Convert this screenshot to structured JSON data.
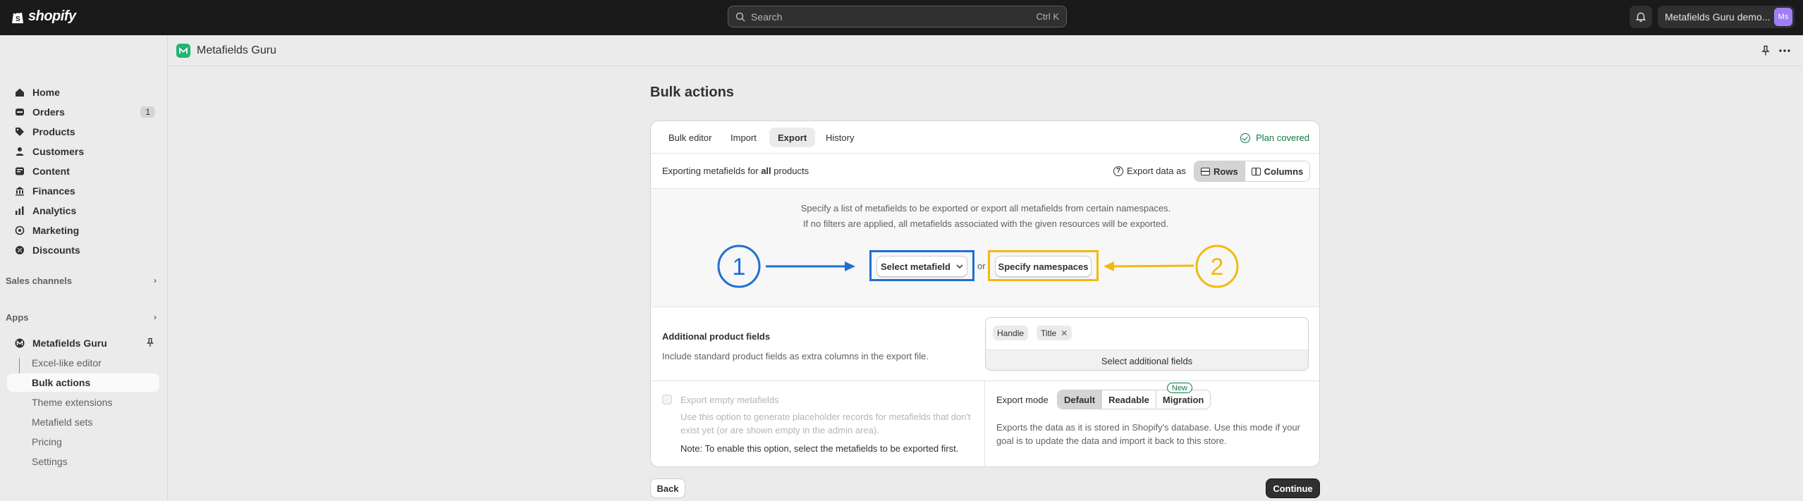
{
  "topbar": {
    "logo_text": "shopify",
    "search_placeholder": "Search",
    "search_shortcut": "Ctrl K",
    "store_name": "Metafields Guru demo...",
    "avatar_initials": "Ms"
  },
  "sidebar": {
    "items": [
      {
        "label": "Home",
        "icon": "home-icon"
      },
      {
        "label": "Orders",
        "icon": "orders-icon",
        "badge": "1"
      },
      {
        "label": "Products",
        "icon": "tag-icon"
      },
      {
        "label": "Customers",
        "icon": "person-icon"
      },
      {
        "label": "Content",
        "icon": "content-icon"
      },
      {
        "label": "Finances",
        "icon": "bank-icon"
      },
      {
        "label": "Analytics",
        "icon": "chart-icon"
      },
      {
        "label": "Marketing",
        "icon": "target-icon"
      },
      {
        "label": "Discounts",
        "icon": "discount-icon"
      }
    ],
    "sales_channels_label": "Sales channels",
    "apps_label": "Apps",
    "app_name": "Metafields Guru",
    "app_subitems": [
      "Excel-like editor",
      "Bulk actions",
      "Theme extensions",
      "Metafield sets",
      "Pricing",
      "Settings"
    ]
  },
  "app_header": {
    "title": "Metafields Guru"
  },
  "page": {
    "title": "Bulk actions",
    "tabs": [
      "Bulk editor",
      "Import",
      "Export",
      "History"
    ],
    "plan_status": "Plan covered",
    "exporting_prefix": "Exporting metafields for ",
    "exporting_bold": "all",
    "exporting_suffix": " products",
    "export_as_label": "Export data as",
    "export_as_options": [
      "Rows",
      "Columns"
    ],
    "hint_line1": "Specify a list of metafields to be exported or export all metafields from certain namespaces.",
    "hint_line2": "If no filters are applied, all metafields associated with the given resources will be exported.",
    "annotation_1": "1",
    "annotation_2": "2",
    "select_metafield_label": "Select metafield",
    "or_text": "or",
    "specify_namespaces_label": "Specify namespaces",
    "additional_title": "Additional product fields",
    "additional_desc": "Include standard product fields as extra columns in the export file.",
    "tags": [
      "Handle",
      "Title"
    ],
    "select_additional_label": "Select additional fields",
    "empty_title": "Export empty metafields",
    "empty_desc": "Use this option to generate placeholder records for metafields that don't exist yet (or are shown empty in the admin area).",
    "empty_note": "Note: To enable this option, select the metafields to be exported first.",
    "export_mode_label": "Export mode",
    "export_modes": [
      "Default",
      "Readable",
      "Migration"
    ],
    "new_badge": "New",
    "export_mode_desc": "Exports the data as it is stored in Shopify's database. Use this mode if your goal is to update the data and import it back to this store.",
    "back_label": "Back",
    "continue_label": "Continue"
  },
  "colors": {
    "annotation_blue": "#1f6fd1",
    "annotation_yellow": "#f2b90f",
    "plan_green": "#0c7a43",
    "app_green": "#22b573"
  }
}
